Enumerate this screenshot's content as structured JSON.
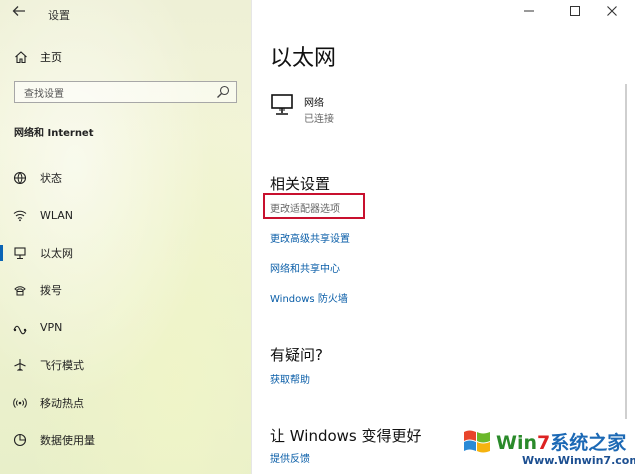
{
  "app": {
    "title": "设置"
  },
  "left": {
    "home_label": "主页",
    "search_placeholder": "查找设置",
    "section_title": "网络和 Internet",
    "nav": [
      {
        "label": "状态",
        "icon": "globe-icon"
      },
      {
        "label": "WLAN",
        "icon": "wifi-icon"
      },
      {
        "label": "以太网",
        "icon": "ethernet-icon",
        "selected": true
      },
      {
        "label": "拨号",
        "icon": "dialup-icon"
      },
      {
        "label": "VPN",
        "icon": "vpn-icon"
      },
      {
        "label": "飞行模式",
        "icon": "airplane-icon"
      },
      {
        "label": "移动热点",
        "icon": "hotspot-icon"
      },
      {
        "label": "数据使用量",
        "icon": "data-usage-icon"
      }
    ]
  },
  "main": {
    "title": "以太网",
    "network": {
      "name": "网络",
      "status": "已连接"
    },
    "related_title": "相关设置",
    "related_links": [
      "更改适配器选项",
      "更改高级共享设置",
      "网络和共享中心",
      "Windows 防火墙"
    ],
    "help_title": "有疑问?",
    "help_link": "获取帮助",
    "improve_title": "让 Windows 变得更好",
    "feedback_link": "提供反馈"
  },
  "watermark": {
    "brand_part1": "Win",
    "brand_seven": "7",
    "brand_cn": "系统之家",
    "url": "Www.Winwin7.com"
  },
  "colors": {
    "accent": "#0a64b5",
    "link": "#0a5ea8",
    "highlight_box": "#c8102e"
  }
}
